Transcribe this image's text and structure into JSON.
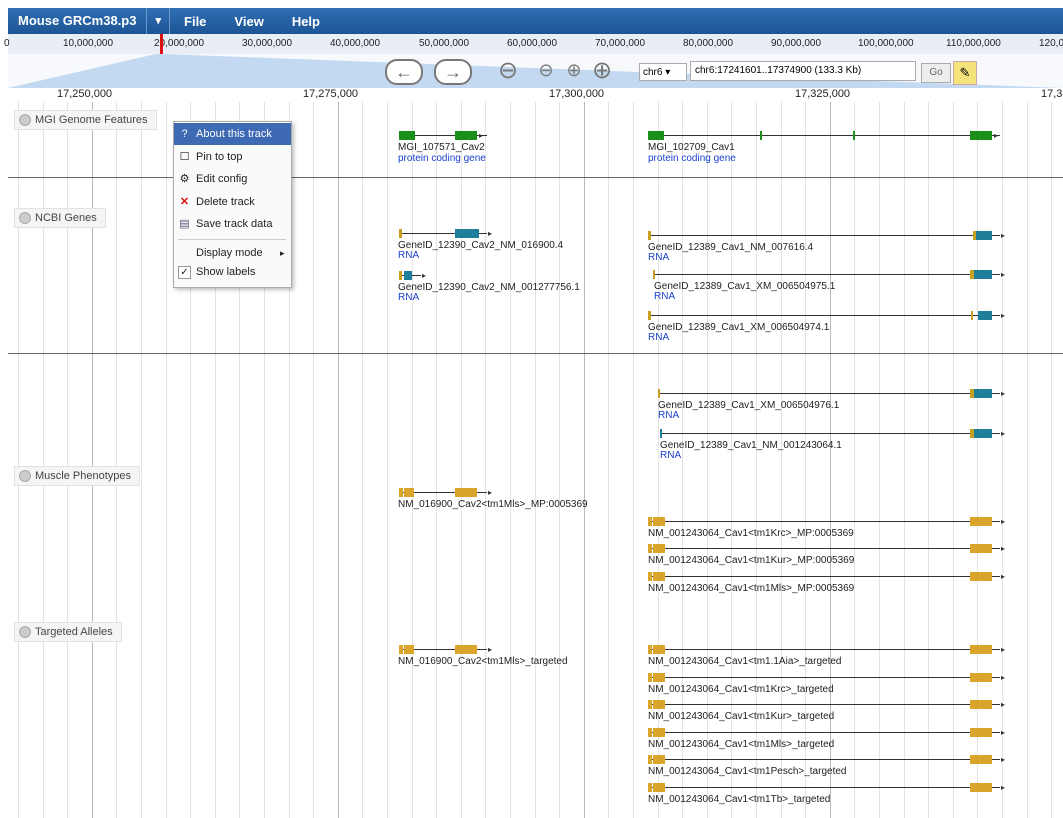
{
  "menubar": {
    "genome": "Mouse GRCm38.p3",
    "dropdown": "▾",
    "file": "File",
    "view": "View",
    "help": "Help"
  },
  "overview": {
    "ticks": [
      "0",
      "10,000,000",
      "20,000,000",
      "30,000,000",
      "40,000,000",
      "50,000,000",
      "60,000,000",
      "70,000,000",
      "80,000,000",
      "90,000,000",
      "100,000,000",
      "110,000,000",
      "120,0"
    ]
  },
  "nav": {
    "back": "←",
    "forward": "→",
    "zoom_out_big": "⊖",
    "zoom_out": "⊖",
    "zoom_in": "⊕",
    "zoom_in_big": "⊕",
    "chrom": "chr6 ▾",
    "location": "chr6:17241601..17374900 (133.3 Kb)",
    "go": "Go",
    "highlight": "✎"
  },
  "ruler": {
    "ticks": [
      "17,250,000",
      "17,275,000",
      "17,300,000",
      "17,325,000",
      "17,3"
    ]
  },
  "tracks": {
    "mgi": {
      "label": "MGI Genome Features"
    },
    "ncbi": {
      "label": "NCBI Genes"
    },
    "muscle": {
      "label": "Muscle Phenotypes"
    },
    "targeted": {
      "label": "Targeted Alleles"
    }
  },
  "features": {
    "mgi": [
      {
        "name": "MGI_107571_Cav2",
        "desc": "protein coding gene"
      },
      {
        "name": "MGI_102709_Cav1",
        "desc": "protein coding gene"
      }
    ],
    "ncbi": [
      {
        "name": "GeneID_12390_Cav2_NM_016900.4",
        "desc": "RNA"
      },
      {
        "name": "GeneID_12390_Cav2_NM_001277756.1",
        "desc": "RNA"
      },
      {
        "name": "GeneID_12389_Cav1_NM_007616.4",
        "desc": "RNA"
      },
      {
        "name": "GeneID_12389_Cav1_XM_006504975.1",
        "desc": "RNA"
      },
      {
        "name": "GeneID_12389_Cav1_XM_006504974.1",
        "desc": "RNA"
      },
      {
        "name": "GeneID_12389_Cav1_XM_006504976.1",
        "desc": "RNA"
      },
      {
        "name": "GeneID_12389_Cav1_NM_001243064.1",
        "desc": "RNA"
      }
    ],
    "muscle": [
      {
        "name": "NM_016900_Cav2<tm1Mls>_MP:0005369"
      },
      {
        "name": "NM_001243064_Cav1<tm1Krc>_MP:0005369"
      },
      {
        "name": "NM_001243064_Cav1<tm1Kur>_MP:0005369"
      },
      {
        "name": "NM_001243064_Cav1<tm1Mls>_MP:0005369"
      }
    ],
    "targeted": [
      {
        "name": "NM_016900_Cav2<tm1Mls>_targeted"
      },
      {
        "name": "NM_001243064_Cav1<tm1.1Aia>_targeted"
      },
      {
        "name": "NM_001243064_Cav1<tm1Krc>_targeted"
      },
      {
        "name": "NM_001243064_Cav1<tm1Kur>_targeted"
      },
      {
        "name": "NM_001243064_Cav1<tm1Mls>_targeted"
      },
      {
        "name": "NM_001243064_Cav1<tm1Pesch>_targeted"
      },
      {
        "name": "NM_001243064_Cav1<tm1Tb>_targeted"
      }
    ]
  },
  "context_menu": {
    "about": "About this track",
    "pin": "Pin to top",
    "edit": "Edit config",
    "delete": "Delete track",
    "save": "Save track data",
    "display_mode": "Display mode",
    "show_labels": "Show labels",
    "icons": {
      "about": "?",
      "pin": "☐",
      "edit": "⚙",
      "delete": "✕",
      "save": "▤",
      "submenu": "▸",
      "check": "✓"
    }
  },
  "colors": {
    "menubar": "#2a65a8",
    "mgi_gene": "#1a8f1a",
    "ncbi_utr": "#c8a021",
    "ncbi_cds": "#1f7f9a",
    "allele": "#d9a52a",
    "rna_text": "#1a3fcc",
    "menu_selected": "#3d6ab3"
  }
}
